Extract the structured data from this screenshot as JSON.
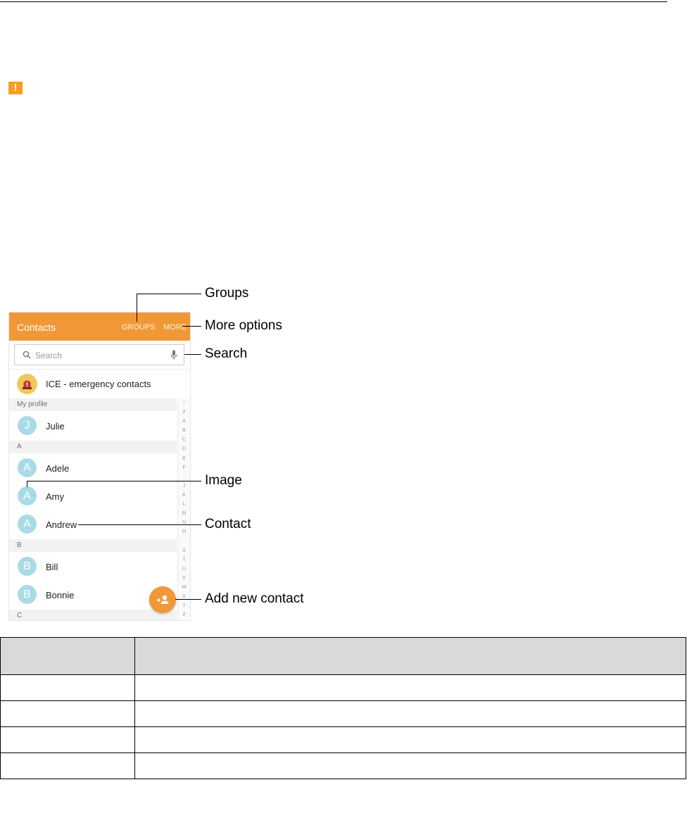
{
  "phone": {
    "appbar": {
      "title": "Contacts",
      "groups": "GROUPS",
      "more": "MORE"
    },
    "search": {
      "placeholder": "Search"
    },
    "ice": {
      "label": "ICE - emergency contacts"
    },
    "sections": [
      {
        "header": "My profile",
        "contacts": [
          {
            "initial": "J",
            "name": "Julie"
          }
        ]
      },
      {
        "header": "A",
        "contacts": [
          {
            "initial": "A",
            "name": "Adele"
          },
          {
            "initial": "A",
            "name": "Amy"
          },
          {
            "initial": "A",
            "name": "Andrew"
          }
        ]
      },
      {
        "header": "B",
        "contacts": [
          {
            "initial": "B",
            "name": "Bill"
          },
          {
            "initial": "B",
            "name": "Bonnie"
          }
        ]
      },
      {
        "header": "C",
        "contacts": []
      }
    ],
    "index_letters": [
      "☆",
      "#",
      "A",
      "B",
      "C",
      "D",
      "E",
      "F",
      "·",
      "J",
      "K",
      "L",
      "M",
      "N",
      "O",
      "·",
      "S",
      "T",
      "U",
      "V",
      "W",
      "X",
      "Y",
      "Z"
    ]
  },
  "callouts": {
    "groups": "Groups",
    "more_options": "More options",
    "search": "Search",
    "image": "Image",
    "contact": "Contact",
    "add_new_contact": "Add new contact"
  },
  "colors": {
    "accent": "#f29737",
    "avatar": "#a9dbe6",
    "warning": "#f59e20"
  },
  "icons": {
    "warning": "warning-icon",
    "search": "search-icon",
    "mic": "microphone-icon",
    "ice": "emergency-siren-icon",
    "fab": "add-contact-icon"
  }
}
